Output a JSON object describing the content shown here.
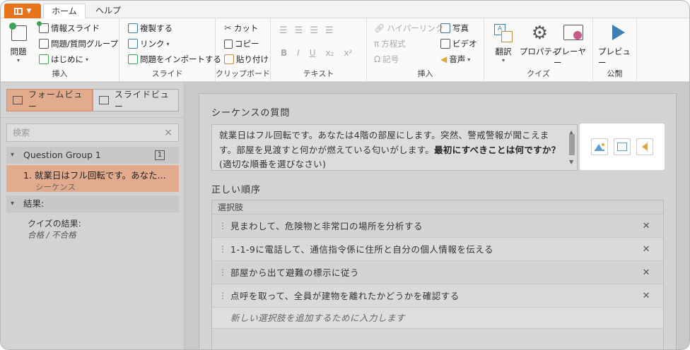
{
  "tabs": {
    "home": "ホーム",
    "help": "ヘルプ"
  },
  "ribbon": {
    "insert1": {
      "label": "挿入",
      "question": "問題",
      "info_slide": "情報スライド",
      "question_group": "問題/質問グループ",
      "intro": "はじめに"
    },
    "slide": {
      "label": "スライド",
      "duplicate": "複製する",
      "link": "リンク",
      "import": "問題をインポートする"
    },
    "clipboard": {
      "label": "クリップボード",
      "cut": "カット",
      "copy": "コピー",
      "paste": "貼り付け"
    },
    "text": {
      "label": "テキスト",
      "bold": "B",
      "italic": "I",
      "underline": "U",
      "sub": "x₂",
      "sup": "x²"
    },
    "insert2": {
      "label": "挿入",
      "hyperlink": "ハイパーリンク",
      "equation": "方程式",
      "symbol": "記号",
      "photo": "写真",
      "video": "ビデオ",
      "audio": "音声"
    },
    "quiz": {
      "label": "クイズ",
      "translate": "翻訳",
      "properties": "プロパティ",
      "player": "プレーヤー"
    },
    "publish": {
      "label": "公開",
      "preview": "プレビュー"
    }
  },
  "left": {
    "form_view": "フォームビュー",
    "slide_view": "スライドビュー",
    "search_placeholder": "検索",
    "group_name": "Question Group 1",
    "group_count": "1",
    "question_title": "1. 就業日はフル回転です。あなた...",
    "question_type": "シーケンス",
    "results_label": "結果:",
    "results_item": "クイズの結果:",
    "results_sub": "合格 / 不合格"
  },
  "main": {
    "section_title": "シーケンスの質問",
    "question_text_plain": "就業日はフル回転です。あなたは4階の部屋にします。突然、警戒警報が聞こえます。部屋を見渡すと何かが燃えている匂いがします。",
    "question_text_bold": "最初にすべきことは何ですか？",
    "question_text_tail": "(適切な順番を選びなさい)",
    "order_title": "正しい順序",
    "options_header": "選択肢",
    "options": [
      "見まわして、危険物と非常口の場所を分析する",
      "1-1-9に電話して、通信指令係に住所と自分の個人情報を伝える",
      "部屋から出て避難の標示に従う",
      "点呼を取って、全員が建物を離れたかどうかを確認する"
    ],
    "add_option_placeholder": "新しい選択肢を追加するために入力します"
  }
}
